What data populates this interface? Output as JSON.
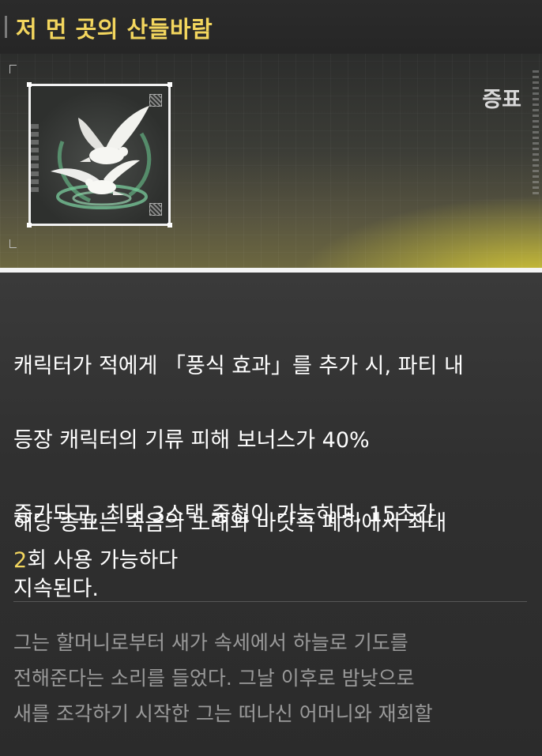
{
  "title": "저 먼 곳의 산들바람",
  "item_type": "증표",
  "icons": {
    "item_icon": "white-doves-icon"
  },
  "colors": {
    "title": "#f3d65e",
    "highlight": "#f3d65e",
    "lore": "#9a9a9a",
    "banner_glow": "#e4d634"
  },
  "description": {
    "effect_lines": [
      "캐릭터가 적에게 「풍식 효과」를 추가 시, 파티 내",
      "등장 캐릭터의 기류 피해 보너스가 40%",
      "증가되고, 최대 3스택 중첩이 가능하며, 15초간",
      "지속된다."
    ],
    "usage_line1": "해당 증표는 죽음의 노래와 바닷속 폐허에서 최대",
    "usage_count": "2",
    "usage_line2_rest": "회 사용 가능하다"
  },
  "lore_lines": [
    "그는 할머니로부터 새가 속세에서 하늘로 기도를",
    "전해준다는 소리를 들었다. 그날 이후로 밤낮으로",
    "새를 조각하기 시작한 그는 떠나신 어머니와 재회할"
  ]
}
